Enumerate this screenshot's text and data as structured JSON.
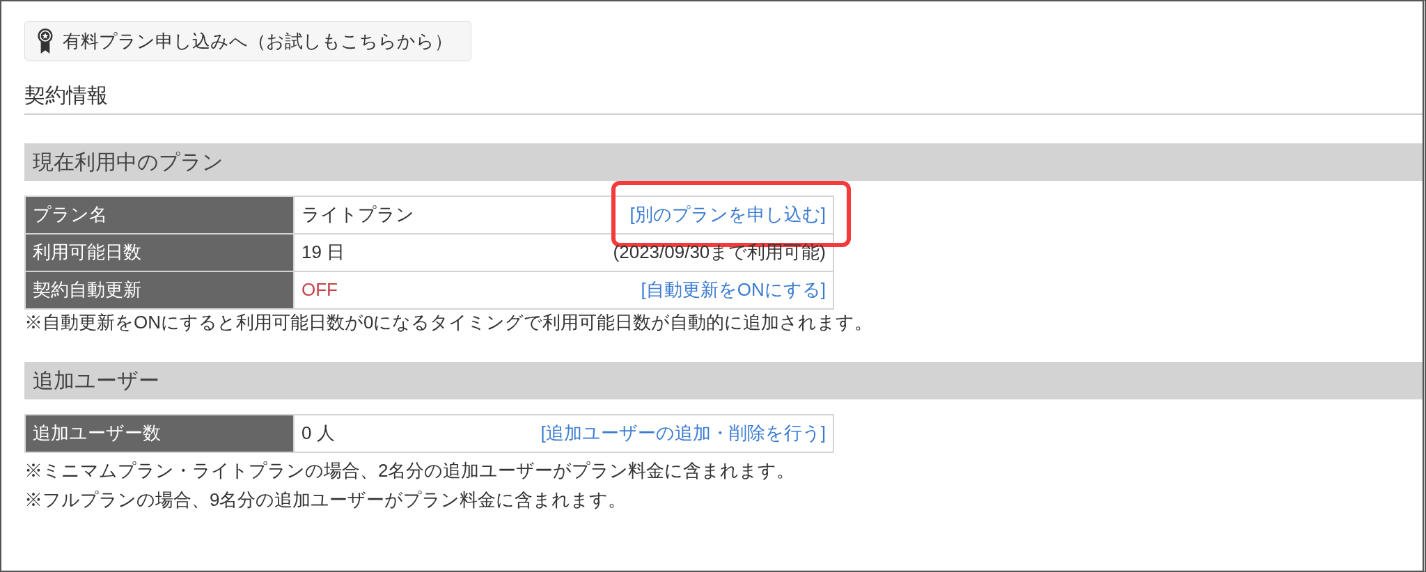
{
  "upgrade_button": {
    "label": "有料プラン申し込みへ（お試しもこちらから）"
  },
  "page_title": "契約情報",
  "sections": [
    {
      "title": "現在利用中のプラン",
      "rows": [
        {
          "label": "プラン名",
          "value": "ライトプラン",
          "alert": false,
          "action": {
            "kind": "link",
            "text": "[別のプランを申し込む]"
          },
          "highlighted": true
        },
        {
          "label": "利用可能日数",
          "value": "19 日",
          "alert": false,
          "action": {
            "kind": "note",
            "text": "(2023/09/30まで利用可能)"
          },
          "highlighted": false
        },
        {
          "label": "契約自動更新",
          "value": "OFF",
          "alert": true,
          "action": {
            "kind": "link",
            "text": "[自動更新をONにする]"
          },
          "highlighted": false
        }
      ],
      "notes": [
        "※自動更新をONにすると利用可能日数が0になるタイミングで利用可能日数が自動的に追加されます。"
      ]
    },
    {
      "title": "追加ユーザー",
      "rows": [
        {
          "label": "追加ユーザー数",
          "value": "0 人",
          "alert": false,
          "action": {
            "kind": "link",
            "text": "[追加ユーザーの追加・削除を行う]"
          },
          "highlighted": false
        }
      ],
      "notes": [
        "※ミニマムプラン・ライトプランの場合、2名分の追加ユーザーがプラン料金に含まれます。",
        "※フルプランの場合、9名分の追加ユーザーがプラン料金に含まれます。"
      ]
    }
  ]
}
